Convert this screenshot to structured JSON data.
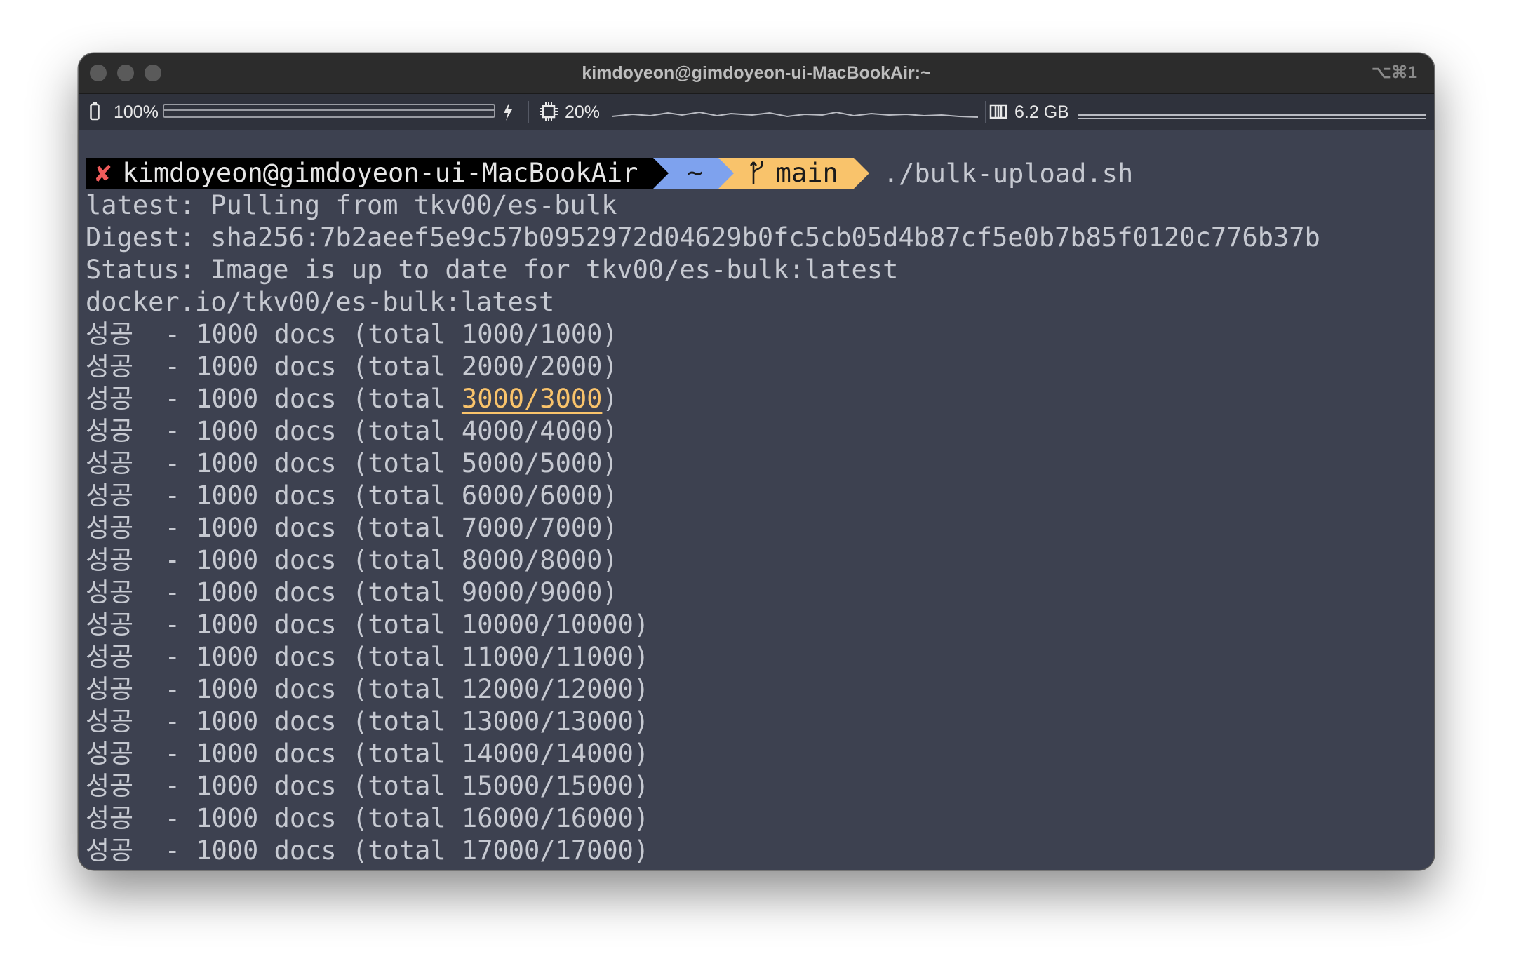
{
  "window": {
    "title": "kimdoyeon@gimdoyeon-ui-MacBookAir:~",
    "shortcut": "⌥⌘1"
  },
  "statusbar": {
    "battery_icon": "battery-icon",
    "battery": "100%",
    "battery_level": 1.0,
    "charging_icon": "lightning-icon",
    "cpu_icon": "cpu-chip-icon",
    "cpu": "20%",
    "memory_icon": "memory-icon",
    "memory": "6.2 GB"
  },
  "prompt": {
    "error_mark": "✘",
    "user_host": "kimdoyeon@gimdoyeon-ui-MacBookAir",
    "dir": "~",
    "branch_icon": "git-branch-icon",
    "branch": "main",
    "command": "./bulk-upload.sh"
  },
  "output": {
    "header_lines": [
      "latest: Pulling from tkv00/es-bulk",
      "Digest: sha256:7b2aeef5e9c57b0952972d04629b0fc5cb05d4b87cf5e0b7b85f0120c776b37b",
      "Status: Image is up to date for tkv00/es-bulk:latest",
      "docker.io/tkv00/es-bulk:latest"
    ],
    "success_word": "성공",
    "batch_text": "- 1000 docs",
    "total_prefix": "(total",
    "totals": [
      "1000/1000",
      "2000/2000",
      "3000/3000",
      "4000/4000",
      "5000/5000",
      "6000/6000",
      "7000/7000",
      "8000/8000",
      "9000/9000",
      "10000/10000",
      "11000/11000",
      "12000/12000",
      "13000/13000",
      "14000/14000",
      "15000/15000",
      "16000/16000",
      "17000/17000"
    ],
    "highlighted_index": 2,
    "highlight_color": "#f9c36b"
  }
}
